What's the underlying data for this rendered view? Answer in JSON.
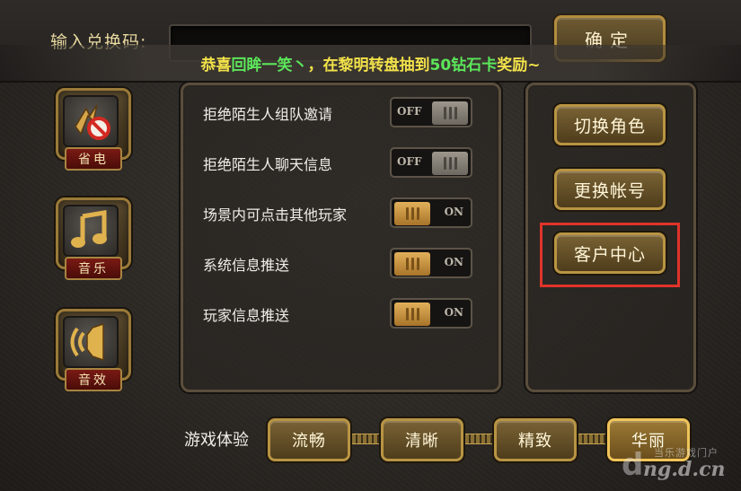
{
  "top_bar": {
    "code_label": "输入兑换码:",
    "code_input_value": "",
    "confirm_label": "确定"
  },
  "banner": {
    "part1": "恭喜",
    "player_name": "回眸一笑丶",
    "part2": "，在黎明转盘抽到",
    "prize": "50钻石卡",
    "part3": "奖励~"
  },
  "sidebar": {
    "power_save": {
      "label": "省电",
      "icon": "power-save-icon"
    },
    "music": {
      "label": "音乐",
      "icon": "music-note-icon"
    },
    "sound": {
      "label": "音效",
      "icon": "speaker-icon"
    }
  },
  "settings": [
    {
      "label": "拒绝陌生人组队邀请",
      "state": "OFF"
    },
    {
      "label": "拒绝陌生人聊天信息",
      "state": "OFF"
    },
    {
      "label": "场景内可点击其他玩家",
      "state": "ON"
    },
    {
      "label": "系统信息推送",
      "state": "ON"
    },
    {
      "label": "玩家信息推送",
      "state": "ON"
    }
  ],
  "account": {
    "switch_role": "切换角色",
    "change_account": "更换帐号",
    "customer_center": "客户中心"
  },
  "quality": {
    "label": "游戏体验",
    "options": [
      "流畅",
      "清晰",
      "精致",
      "华丽"
    ],
    "selected": "华丽"
  },
  "watermark": {
    "top": "当乐游戏门户",
    "bottom": "ng.d.cn",
    "logo_letter": "d"
  },
  "colors": {
    "banner_text": "#f2e24a",
    "banner_highlight": "#5ce65a",
    "gold_border": "#b89443",
    "highlight_box": "#e0332a"
  }
}
